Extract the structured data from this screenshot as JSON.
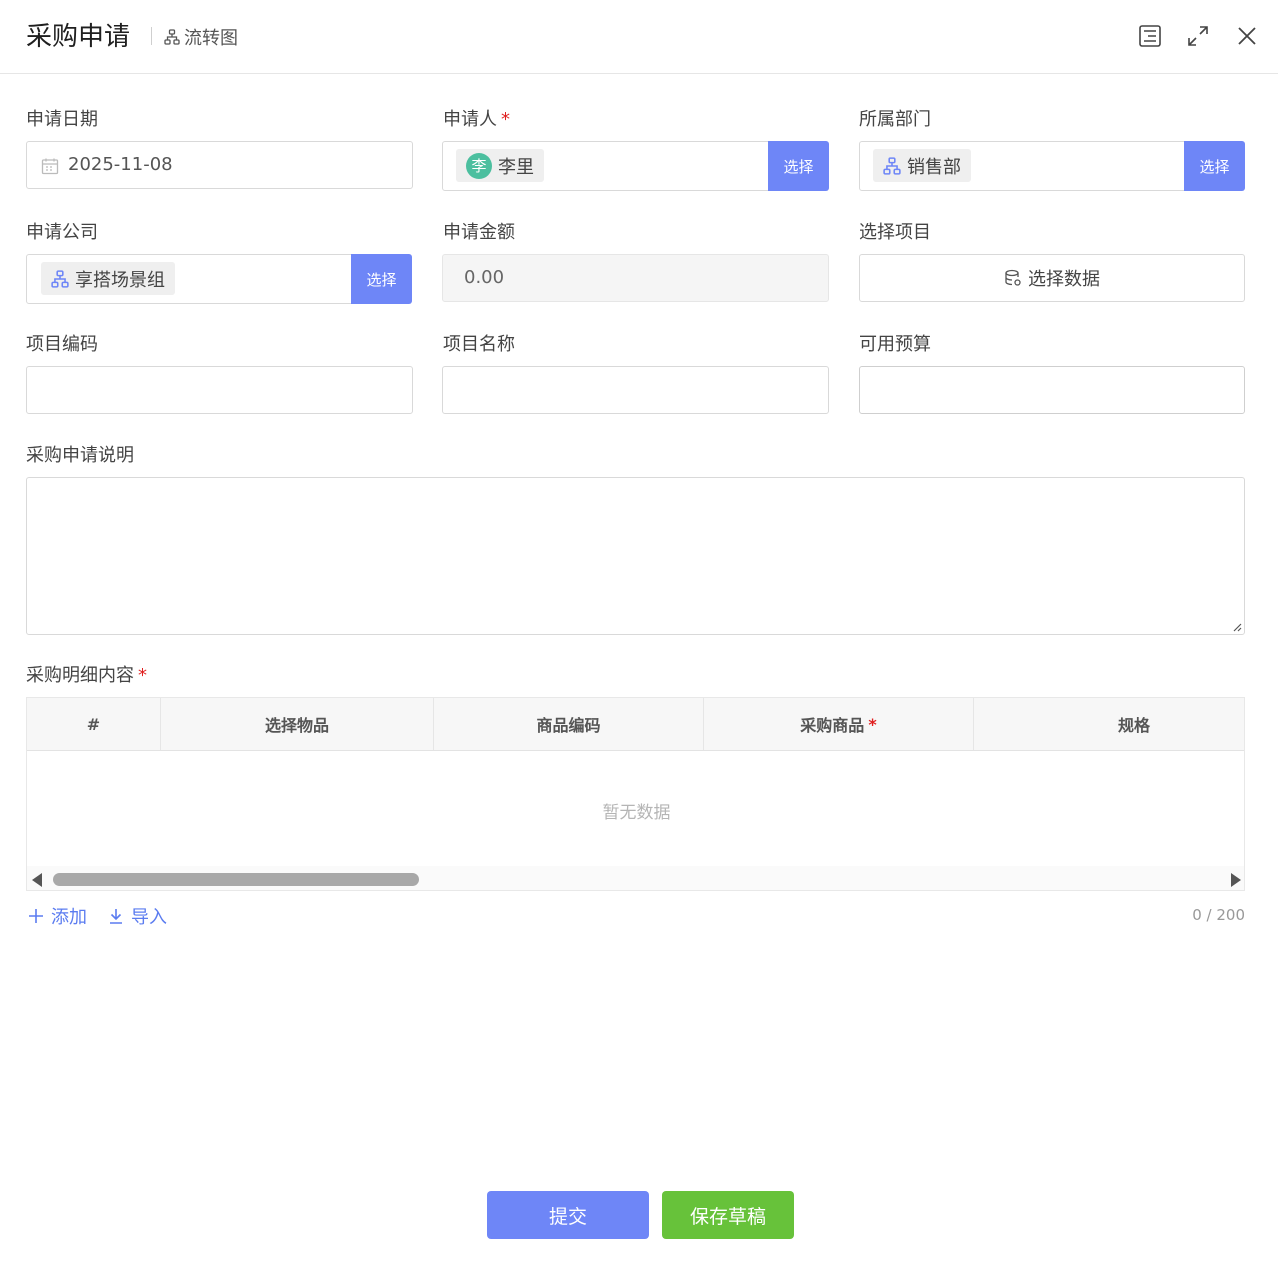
{
  "header": {
    "title": "采购申请",
    "flow_label": "流转图",
    "icons": [
      "side-panel-icon",
      "expand-icon",
      "close-icon"
    ]
  },
  "form": {
    "apply_date": {
      "label": "申请日期",
      "value": "2025-11-08"
    },
    "applicant": {
      "label": "申请人",
      "required": "*",
      "avatar_char": "李",
      "value": "李里",
      "button": "选择"
    },
    "department": {
      "label": "所属部门",
      "value": "销售部",
      "button": "选择"
    },
    "company": {
      "label": "申请公司",
      "value": "享搭场景组",
      "button": "选择"
    },
    "amount": {
      "label": "申请金额",
      "value": "0.00"
    },
    "project": {
      "label": "选择项目",
      "button": "选择数据"
    },
    "project_code": {
      "label": "项目编码",
      "value": ""
    },
    "project_name": {
      "label": "项目名称",
      "value": ""
    },
    "budget": {
      "label": "可用预算",
      "value": ""
    },
    "description": {
      "label": "采购申请说明",
      "value": ""
    }
  },
  "details": {
    "label": "采购明细内容",
    "required": "*",
    "columns": [
      "#",
      "选择物品",
      "商品编码",
      "采购商品",
      "规格"
    ],
    "required_mark": "*",
    "empty_text": "暂无数据",
    "add_label": "添加",
    "import_label": "导入",
    "counter": "0 / 200"
  },
  "footer": {
    "submit_label": "提交",
    "draft_label": "保存草稿"
  },
  "colors": {
    "primary": "#6e86f7",
    "success": "#67c23a",
    "required": "#e02020",
    "link": "#5b7cf0"
  }
}
